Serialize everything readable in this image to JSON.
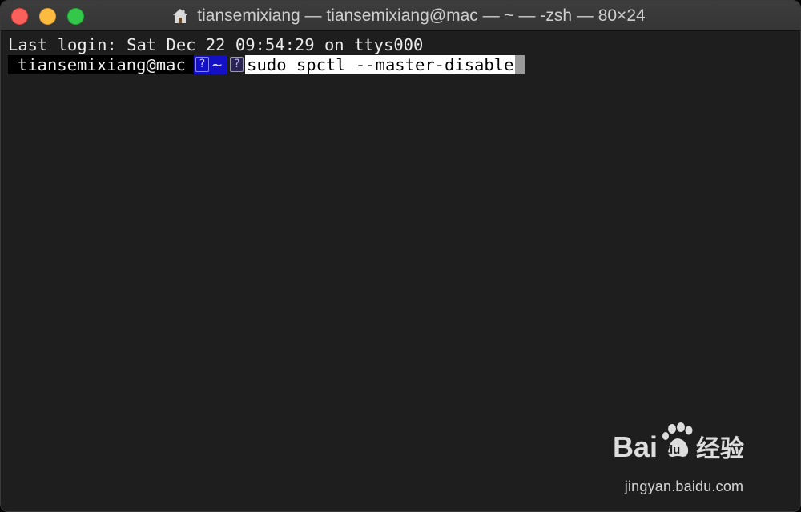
{
  "window": {
    "title": "tiansemixiang — tiansemixiang@mac — ~ — -zsh — 80×24",
    "title_icon": "home-folder-icon",
    "controls": [
      "close-button",
      "minimize-button",
      "zoom-button"
    ]
  },
  "terminal": {
    "last_login": "Last login: Sat Dec 22 09:54:29 on ttys000",
    "prompt_user": "tiansemixiang@mac",
    "prompt_dir": "~",
    "glyph": "?",
    "command": "sudo spctl --master-disable"
  },
  "colors": {
    "background": "#1e1e1e",
    "prompt_user_bg": "#000000",
    "prompt_dir_bg": "#1410c8",
    "command_highlight": "#ffffff"
  },
  "watermark": {
    "logo_text": "Bai du 经验",
    "url": "jingyan.baidu.com"
  }
}
